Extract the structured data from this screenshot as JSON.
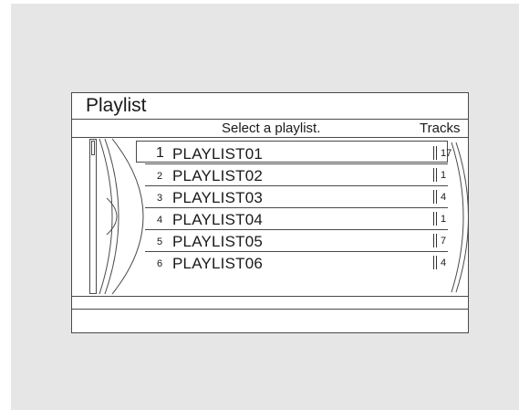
{
  "title": "Playlist",
  "header": {
    "prompt": "Select a playlist.",
    "tracks_label": "Tracks"
  },
  "playlists": [
    {
      "number": "1",
      "name": "PLAYLIST01",
      "tracks": "17",
      "selected": true
    },
    {
      "number": "2",
      "name": "PLAYLIST02",
      "tracks": "1"
    },
    {
      "number": "3",
      "name": "PLAYLIST03",
      "tracks": "4"
    },
    {
      "number": "4",
      "name": "PLAYLIST04",
      "tracks": "1"
    },
    {
      "number": "5",
      "name": "PLAYLIST05",
      "tracks": "7"
    },
    {
      "number": "6",
      "name": "PLAYLIST06",
      "tracks": "4"
    }
  ],
  "scroll_position": 0
}
